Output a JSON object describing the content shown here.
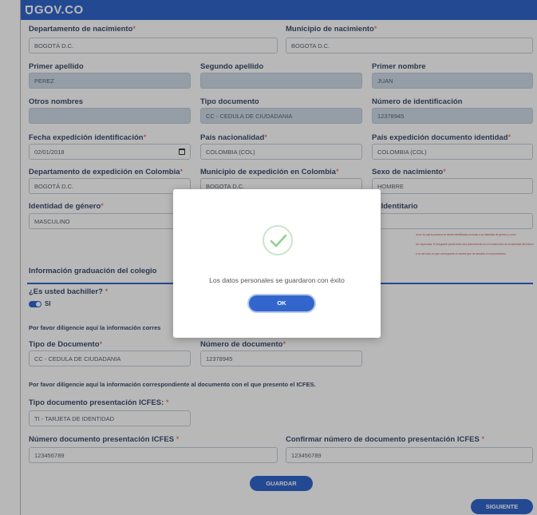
{
  "header": {
    "logo": "GOV.CO"
  },
  "labels": {
    "depto_nac": "Departamento de nacimiento",
    "mun_nac": "Municipio de nacimiento",
    "primer_apellido": "Primer apellido",
    "segundo_apellido": "Segundo apellido",
    "primer_nombre": "Primer nombre",
    "otros_nombres": "Otros nombres",
    "tipo_doc": "Tipo documento",
    "num_ident": "Número de identificación",
    "fecha_exp": "Fecha expedición identificación",
    "pais_nac": "País nacionalidad",
    "pais_exp": "País expedición documento identidad",
    "depto_exp": "Departamento de expedición en Colombia",
    "mun_exp": "Municipio de expedición en Colombia",
    "sexo": "Sexo de nacimiento",
    "identidad_genero": "Identidad de género",
    "nombre_ident_tail": "re Identitario",
    "section_title": "Información graduación del colegio",
    "bachiller_q": "¿Es usted bachiller?",
    "toggle_si": "SI",
    "por_favor_1": "Por favor diligencie aquí la información corres",
    "tipo_documento": "Tipo de Documento",
    "numero_documento": "Número de documento",
    "por_favor_2": "Por favor diligencie aquí la información correspondiente al documento con el que presento el ICFES.",
    "tipo_doc_icfes": "Tipo documento presentación ICFES:",
    "num_doc_icfes": "Número documento presentación ICFES",
    "confirm_icfes": "Confirmar número de documento presentación ICFES",
    "required_mark": "*"
  },
  "values": {
    "depto_nac": "BOGOTÁ D.C.",
    "mun_nac": "BOGOTA D.C.",
    "primer_apellido": "PEREZ",
    "segundo_apellido": "",
    "primer_nombre": "JUAN",
    "otros_nombres": "",
    "tipo_doc": "CC - CEDULA DE CIUDADANIA",
    "num_ident": "12378945",
    "fecha_exp": "02/01/2018",
    "pais_nac": "COLOMBIA (COL)",
    "pais_exp": "COLOMBIA (COL)",
    "depto_exp": "BOGOTÁ D.C.",
    "mun_exp": "BOGOTA D.C.",
    "sexo": "HOMBRE",
    "identidad_genero": "MASCULINO",
    "nombre_ident": "",
    "tipo_documento": "CC - CEDULA DE CIUDADANIA",
    "numero_documento": "12378945",
    "tipo_doc_icfes": "TI - TARJETA DE IDENTIDAD",
    "num_doc_icfes": "123456789",
    "confirm_icfes": "123456789"
  },
  "warning_lines": [
    "ón en la cual la persona se siente identificada con base a su identidad de género y como",
    "ser expresada. El integrante puede tener una preeminencia en el construcción de la identidad del mismo",
    "e un ser todo, es que corresponde al nombre que ha decidido el reconocimiento"
  ],
  "buttons": {
    "guardar": "GUARDAR",
    "siguiente": "SIGUIENTE"
  },
  "modal": {
    "message": "Los datos personales se guardaron con éxito",
    "ok": "OK"
  },
  "colors": {
    "primary": "#3366cc",
    "required": "#e0503c",
    "success": "#8cd18f"
  }
}
